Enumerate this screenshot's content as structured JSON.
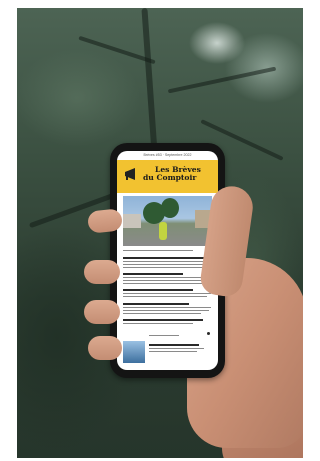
{
  "newsletter": {
    "issue_line": "Brèves #53 · Septembre 2022",
    "title_line1": "Les Brèves",
    "title_line2": "du Comptoir",
    "banner_color": "#f2c230",
    "icon": "megaphone-icon"
  },
  "colors": {
    "background_foliage": "#3a4f40",
    "phone_body": "#141414",
    "skin": "#c98f74"
  }
}
